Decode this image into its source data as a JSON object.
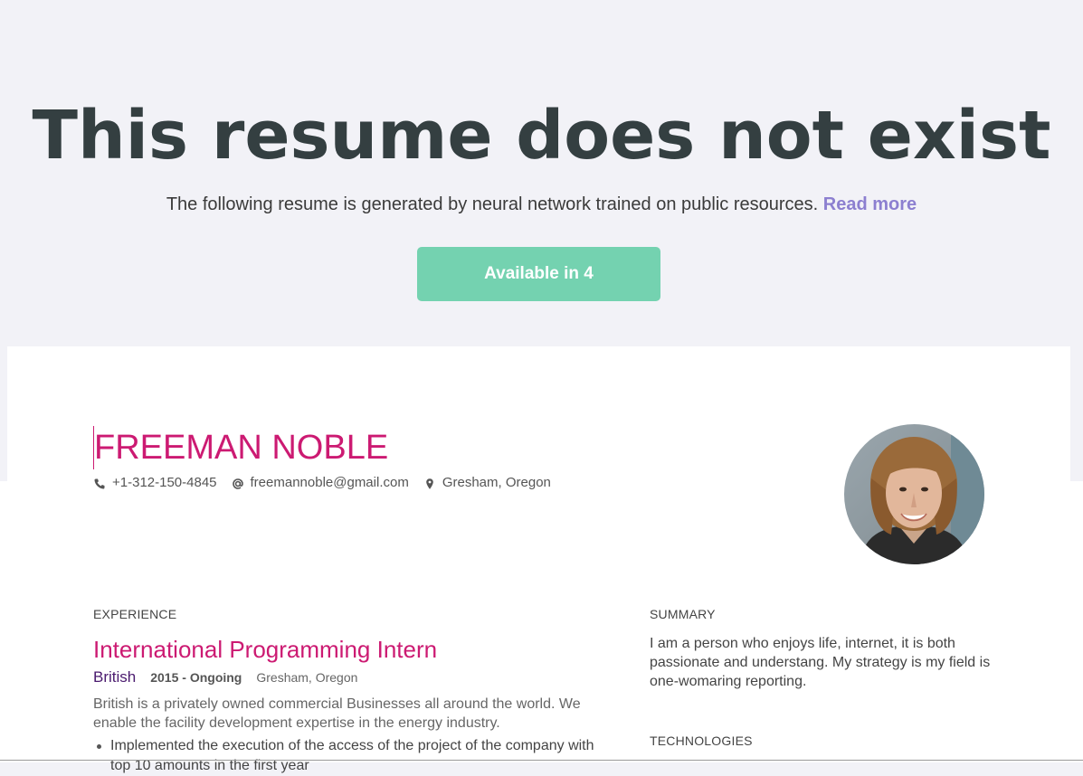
{
  "hero": {
    "title": "This resume does not exist",
    "subtitle": "The following resume is generated by neural network trained on public resources.",
    "read_more": "Read more",
    "button_label": "Available in 4"
  },
  "resume": {
    "name": "FREEMAN NOBLE",
    "contacts": {
      "phone": "+1-312-150-4845",
      "email": "freemannoble@gmail.com",
      "location": "Gresham, Oregon"
    },
    "experience": {
      "heading": "EXPERIENCE",
      "jobs": [
        {
          "title": "International Programming Intern",
          "company": "British",
          "dates": "2015 - Ongoing",
          "location": "Gresham, Oregon",
          "description": "British is a privately owned commercial Businesses all around the world. We enable the facility development expertise in the energy industry.",
          "bullets": [
            "Implemented the execution of the access of the project of the company with top 10 amounts in the first year"
          ]
        }
      ]
    },
    "summary": {
      "heading": "SUMMARY",
      "text": "I am a person who enjoys life, internet, it is both passionate and understang. My strategy is my field is one-womaring reporting."
    },
    "technologies": {
      "heading": "TECHNOLOGIES"
    }
  },
  "colors": {
    "page_bg": "#f2f2f7",
    "title": "#343f41",
    "accent_link": "#8c7fd0",
    "button": "#74d2b0",
    "name_accent": "#cc1a72",
    "company": "#4a1a6e"
  },
  "icons": [
    "phone-icon",
    "at-icon",
    "map-pin-icon"
  ]
}
